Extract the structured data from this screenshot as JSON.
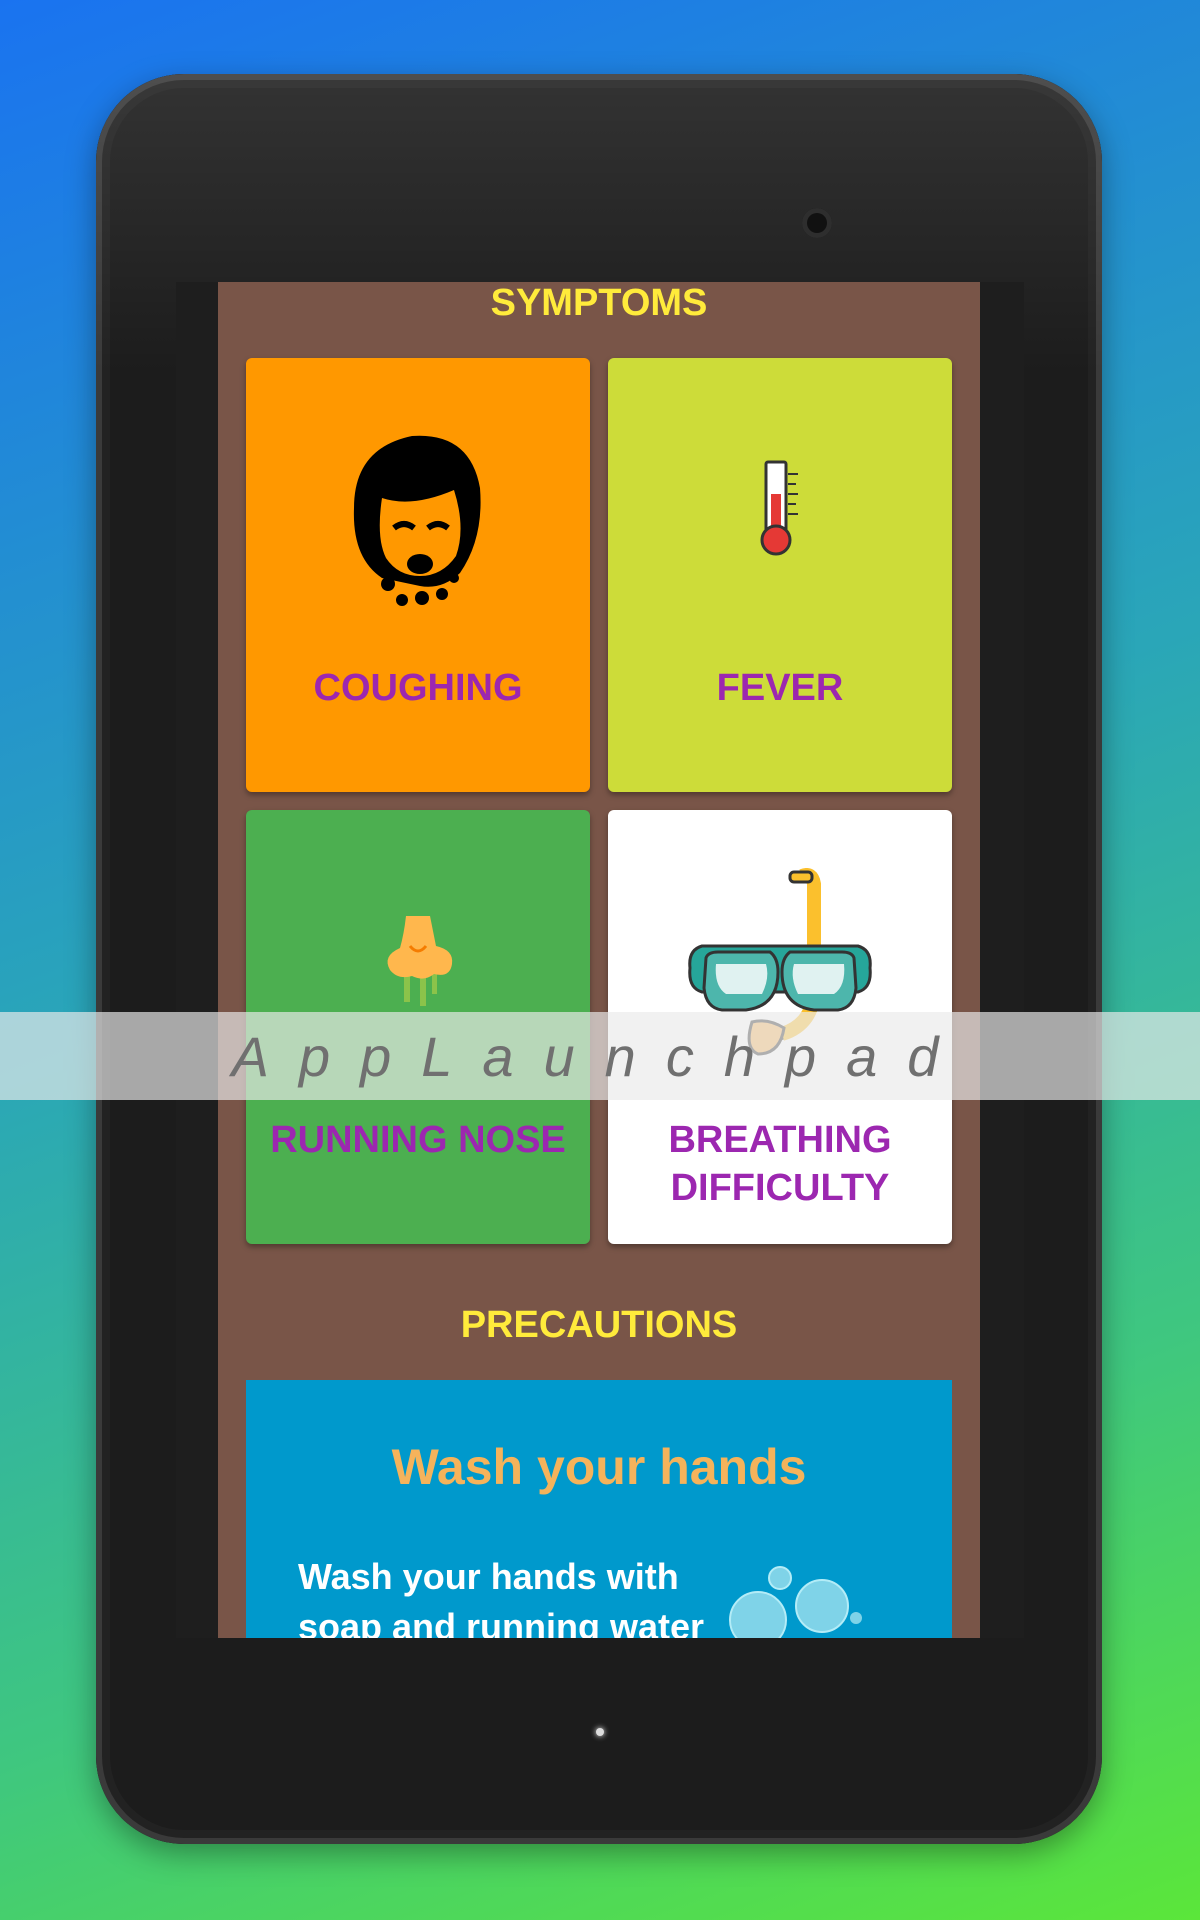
{
  "symptoms": {
    "title": "SYMPTOMS",
    "cards": [
      {
        "label": "COUGHING",
        "icon": "coughing-face-icon",
        "color": "#ff9800"
      },
      {
        "label": "FEVER",
        "icon": "thermometer-icon",
        "color": "#cddc39"
      },
      {
        "label": "RUNNING NOSE",
        "icon": "runny-nose-icon",
        "color": "#4caf50"
      },
      {
        "label_line1": "BREATHING",
        "label_line2": "DIFFICULTY",
        "icon": "snorkel-mask-icon",
        "color": "#ffffff"
      }
    ]
  },
  "precautions": {
    "title": "PRECAUTIONS",
    "card": {
      "heading": "Wash your hands",
      "text_line1": "Wash your hands with",
      "text_line2": "soap and running water",
      "icon": "soap-bubbles-icon",
      "color": "#0099cc"
    }
  },
  "watermark": "AppLaunchpad",
  "colors": {
    "panel": "#795548",
    "title": "#ffeb3b",
    "label": "#9c27b0"
  }
}
